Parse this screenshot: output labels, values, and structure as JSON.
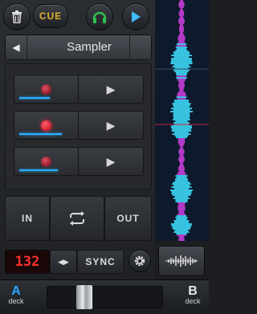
{
  "topbar": {
    "trash_icon": "trash-icon",
    "cue_label": "CUE",
    "headphones_icon": "headphones-icon",
    "play_icon": "play-icon"
  },
  "sampler": {
    "title": "Sampler",
    "rows": [
      {
        "active": false,
        "progress": 0.57
      },
      {
        "active": true,
        "progress": 0.79
      },
      {
        "active": false,
        "progress": 0.71
      }
    ]
  },
  "loop": {
    "in_label": "IN",
    "out_label": "OUT"
  },
  "tempo": {
    "bpm": "132",
    "sync_label": "SYNC"
  },
  "crossfader": {
    "deck_a_letter": "A",
    "deck_a_label": "deck",
    "deck_b_letter": "B",
    "deck_b_label": "deck",
    "position": 0.29
  },
  "colors": {
    "accent_blue": "#2ab0ff",
    "cue_yellow": "#e0b030",
    "bpm_red": "#ff3030",
    "headphones_green": "#30c050",
    "wave_magenta": "#d040e0",
    "wave_cyan": "#40e0ff"
  }
}
